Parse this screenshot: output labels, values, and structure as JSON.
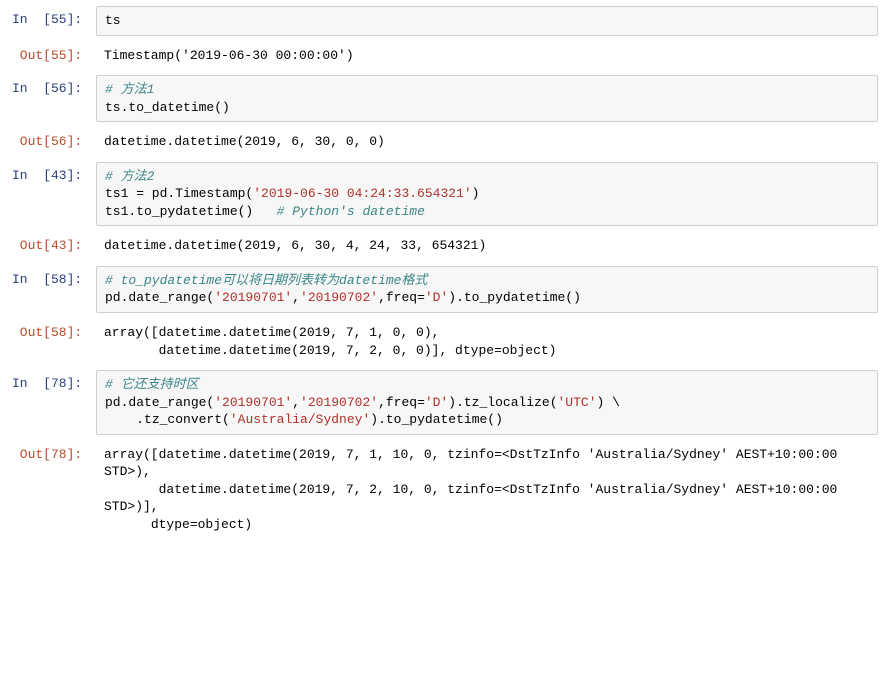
{
  "cells": {
    "c55": {
      "in_prompt": "In  [55]: ",
      "out_prompt": "Out[55]: ",
      "code": "ts",
      "output": "Timestamp('2019-06-30 00:00:00')"
    },
    "c56": {
      "in_prompt": "In  [56]: ",
      "out_prompt": "Out[56]: ",
      "comment": "# 方法1",
      "code_line": "ts.to_datetime()",
      "output": "datetime.datetime(2019, 6, 30, 0, 0)"
    },
    "c43": {
      "in_prompt": "In  [43]: ",
      "out_prompt": "Out[43]: ",
      "comment": "# 方法2",
      "line2_pre": "ts1 = pd.Timestamp(",
      "line2_str": "'2019-06-30 04:24:33.654321'",
      "line2_post": ")",
      "line3_code": "ts1.to_pydatetime()   ",
      "line3_comment": "# Python's datetime",
      "output": "datetime.datetime(2019, 6, 30, 4, 24, 33, 654321)"
    },
    "c58": {
      "in_prompt": "In  [58]: ",
      "out_prompt": "Out[58]: ",
      "comment": "# to_pydatetime可以将日期列表转为datetime格式",
      "line2_a": "pd.date_range(",
      "line2_s1": "'20190701'",
      "line2_b": ",",
      "line2_s2": "'20190702'",
      "line2_c": ",freq=",
      "line2_s3": "'D'",
      "line2_d": ").to_pydatetime()",
      "output": "array([datetime.datetime(2019, 7, 1, 0, 0),\n       datetime.datetime(2019, 7, 2, 0, 0)], dtype=object)"
    },
    "c78": {
      "in_prompt": "In  [78]: ",
      "out_prompt": "Out[78]: ",
      "comment": "# 它还支持时区",
      "line2_a": "pd.date_range(",
      "line2_s1": "'20190701'",
      "line2_b": ",",
      "line2_s2": "'20190702'",
      "line2_c": ",freq=",
      "line2_s3": "'D'",
      "line2_d": ").tz_localize(",
      "line2_s4": "'UTC'",
      "line2_e": ") \\",
      "line3_a": "    .tz_convert(",
      "line3_s1": "'Australia/Sydney'",
      "line3_b": ").to_pydatetime()",
      "output": "array([datetime.datetime(2019, 7, 1, 10, 0, tzinfo=<DstTzInfo 'Australia/Sydney' AEST+10:00:00 STD>),\n       datetime.datetime(2019, 7, 2, 10, 0, tzinfo=<DstTzInfo 'Australia/Sydney' AEST+10:00:00 STD>)],\n      dtype=object)"
    }
  }
}
